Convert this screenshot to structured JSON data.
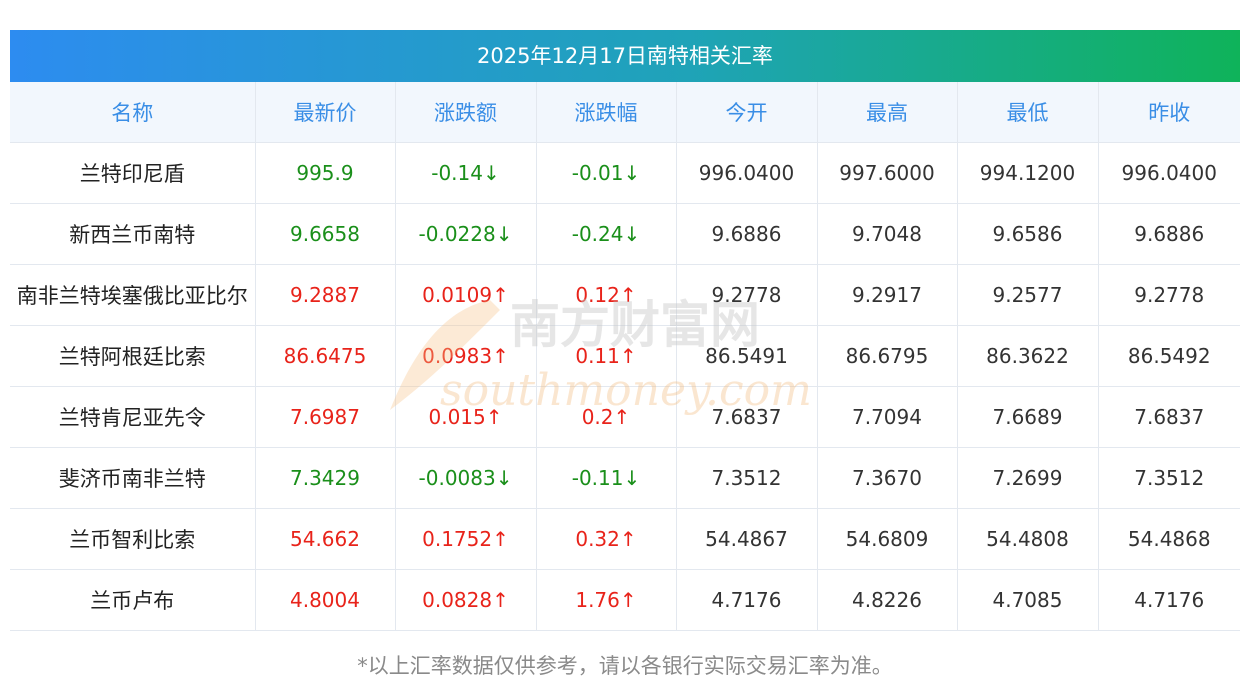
{
  "title": "2025年12月17日南特相关汇率",
  "headers": [
    "名称",
    "最新价",
    "涨跌额",
    "涨跌幅",
    "今开",
    "最高",
    "最低",
    "昨收"
  ],
  "rows": [
    {
      "name": "兰特印尼盾",
      "latest": "995.9",
      "change": "-0.14↓",
      "change_pct": "-0.01↓",
      "open": "996.0400",
      "high": "997.6000",
      "low": "994.1200",
      "prev_close": "996.0400",
      "dir": "down"
    },
    {
      "name": "新西兰币南特",
      "latest": "9.6658",
      "change": "-0.0228↓",
      "change_pct": "-0.24↓",
      "open": "9.6886",
      "high": "9.7048",
      "low": "9.6586",
      "prev_close": "9.6886",
      "dir": "down"
    },
    {
      "name": "南非兰特埃塞俄比亚比尔",
      "latest": "9.2887",
      "change": "0.0109↑",
      "change_pct": "0.12↑",
      "open": "9.2778",
      "high": "9.2917",
      "low": "9.2577",
      "prev_close": "9.2778",
      "dir": "up"
    },
    {
      "name": "兰特阿根廷比索",
      "latest": "86.6475",
      "change": "0.0983↑",
      "change_pct": "0.11↑",
      "open": "86.5491",
      "high": "86.6795",
      "low": "86.3622",
      "prev_close": "86.5492",
      "dir": "up"
    },
    {
      "name": "兰特肯尼亚先令",
      "latest": "7.6987",
      "change": "0.015↑",
      "change_pct": "0.2↑",
      "open": "7.6837",
      "high": "7.7094",
      "low": "7.6689",
      "prev_close": "7.6837",
      "dir": "up"
    },
    {
      "name": "斐济币南非兰特",
      "latest": "7.3429",
      "change": "-0.0083↓",
      "change_pct": "-0.11↓",
      "open": "7.3512",
      "high": "7.3670",
      "low": "7.2699",
      "prev_close": "7.3512",
      "dir": "down"
    },
    {
      "name": "兰币智利比索",
      "latest": "54.662",
      "change": "0.1752↑",
      "change_pct": "0.32↑",
      "open": "54.4867",
      "high": "54.6809",
      "low": "54.4808",
      "prev_close": "54.4868",
      "dir": "up"
    },
    {
      "name": "兰币卢布",
      "latest": "4.8004",
      "change": "0.0828↑",
      "change_pct": "1.76↑",
      "open": "4.7176",
      "high": "4.8226",
      "low": "4.7085",
      "prev_close": "4.7176",
      "dir": "up"
    }
  ],
  "colors": {
    "up": "#e8231a",
    "down": "#1a8f1a",
    "header_text": "#3a8ee6"
  },
  "watermark": {
    "cn": "南方财富网",
    "en": "southmoney.com"
  },
  "footnote": "*以上汇率数据仅供参考，请以各银行实际交易汇率为准。"
}
